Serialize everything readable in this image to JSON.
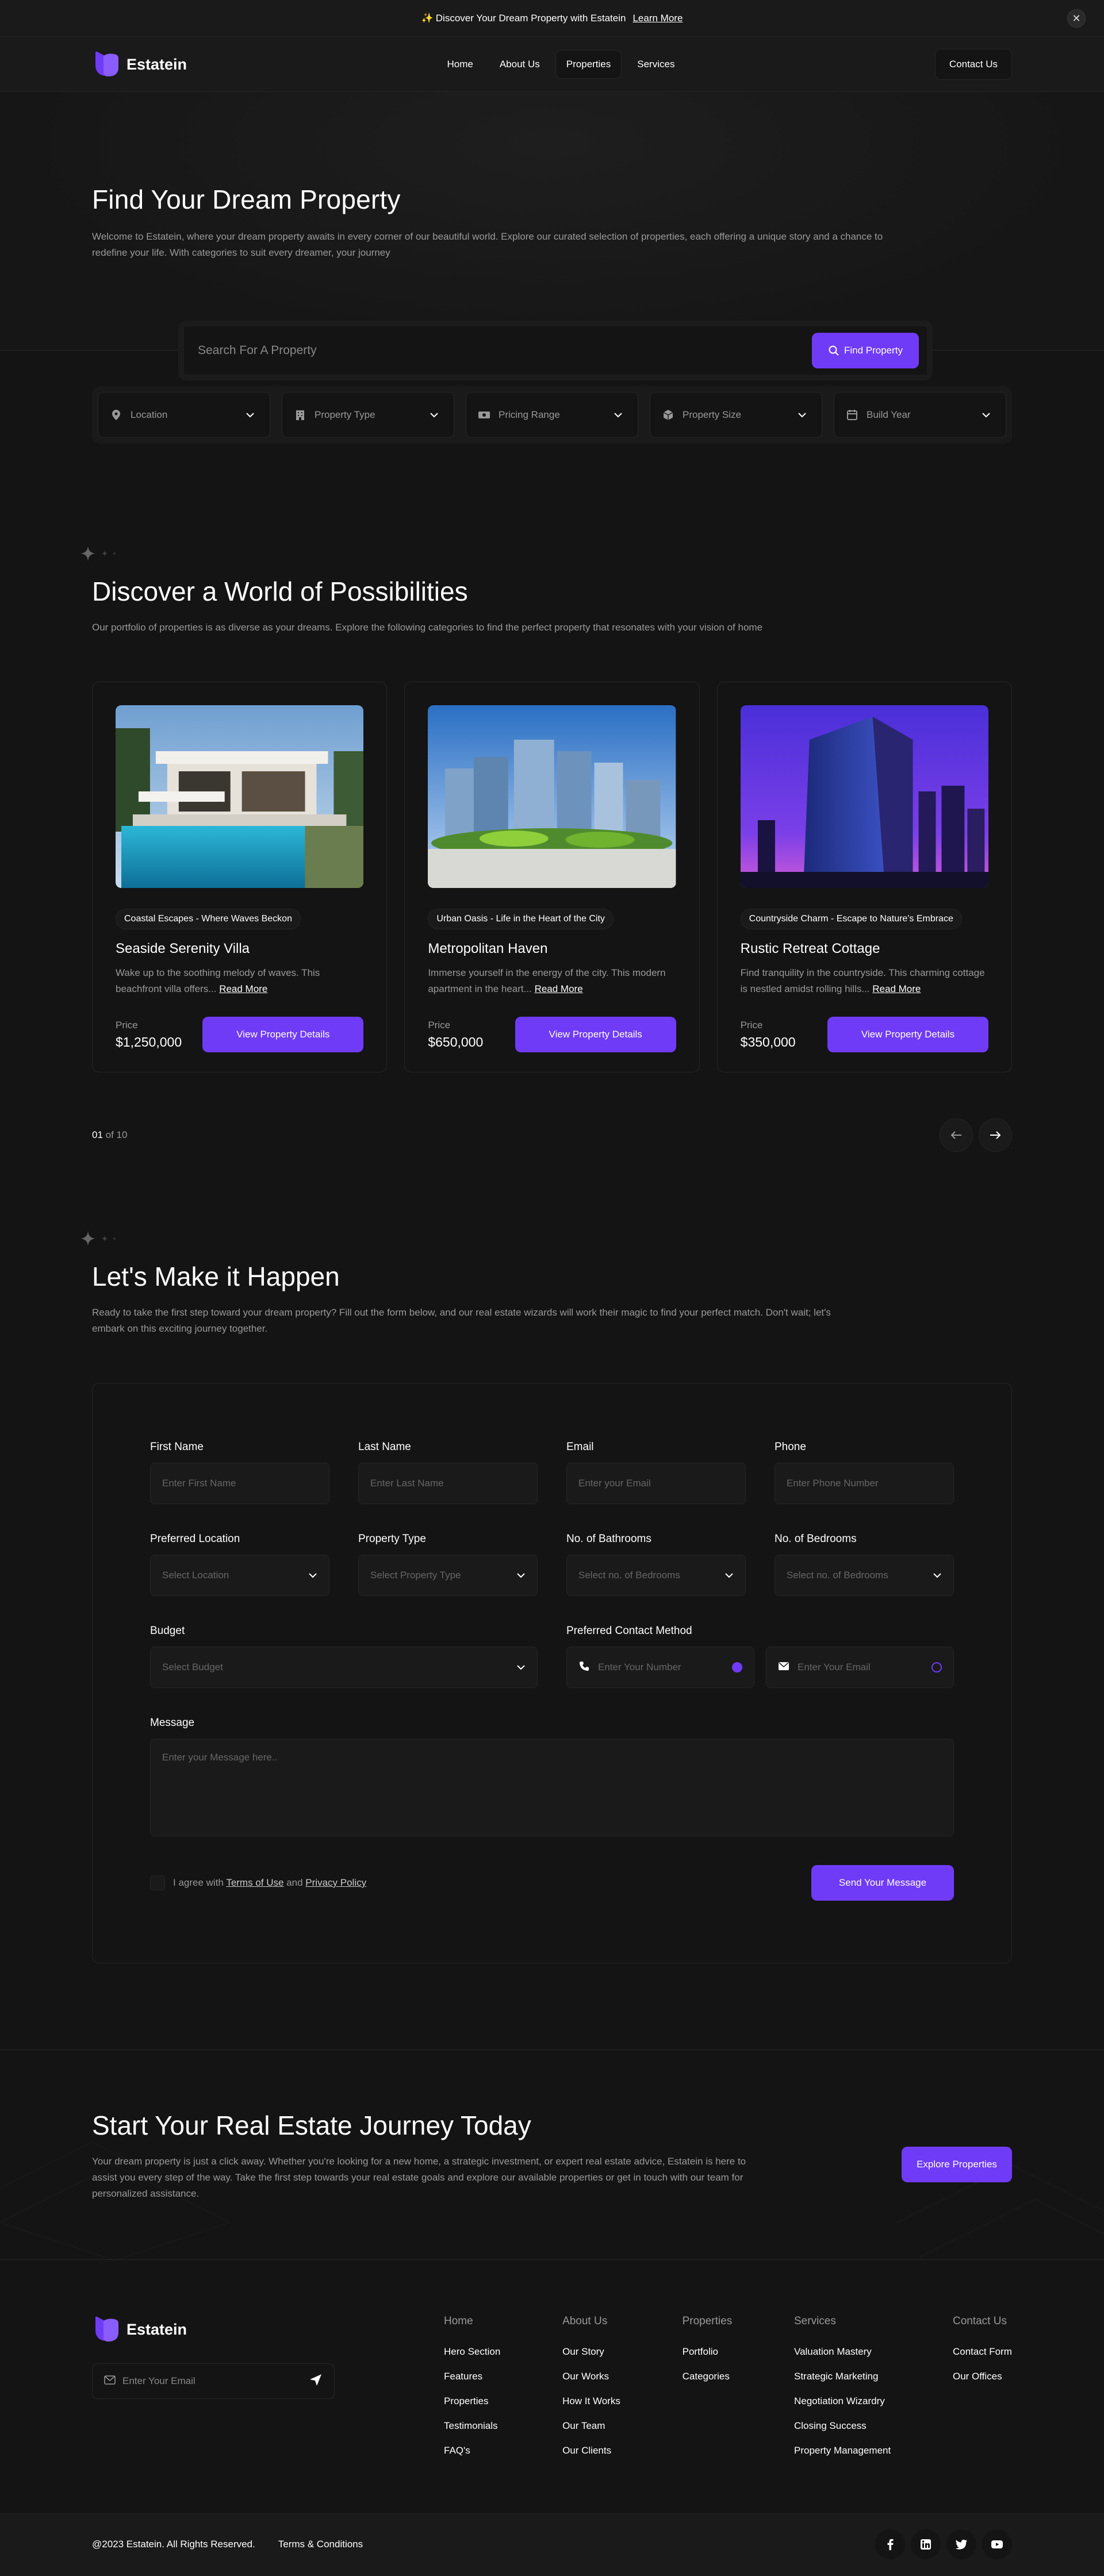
{
  "banner": {
    "text": "Discover Your Dream Property with Estatein",
    "link": "Learn More"
  },
  "brand": {
    "name": "Estatein",
    "accent": "#703bf7"
  },
  "nav": {
    "items": [
      "Home",
      "About Us",
      "Properties",
      "Services"
    ],
    "contact": "Contact Us"
  },
  "hero": {
    "title": "Find Your Dream Property",
    "text": "Welcome to Estatein, where your dream property awaits in every corner of our beautiful world. Explore our curated selection of properties, each offering a unique story and a chance to redefine your life. With categories to suit every dreamer, your journey"
  },
  "search": {
    "placeholder": "Search For A Property",
    "button": "Find Property",
    "filters": [
      "Location",
      "Property Type",
      "Pricing Range",
      "Property Size",
      "Build Year"
    ]
  },
  "discover": {
    "title": "Discover a World of Possibilities",
    "text": "Our portfolio of properties is as diverse as your dreams. Explore the following categories to find the perfect property that resonates with your vision of home",
    "price_label": "Price",
    "details_button": "View Property Details",
    "read_more": "Read More",
    "cards": [
      {
        "tag": "Coastal Escapes - Where Waves Beckon",
        "title": "Seaside Serenity Villa",
        "desc": "Wake up to the soothing melody of waves. This beachfront villa offers...",
        "price": "$1,250,000"
      },
      {
        "tag": "Urban Oasis - Life in the Heart of the City",
        "title": "Metropolitan Haven",
        "desc": "Immerse yourself in the energy of the city. This modern apartment in the heart...",
        "price": "$650,000"
      },
      {
        "tag": "Countryside Charm - Escape to Nature's Embrace",
        "title": "Rustic Retreat Cottage",
        "desc": "Find tranquility in the countryside. This charming cottage is nestled amidst rolling hills...",
        "price": "$350,000"
      }
    ],
    "pager": {
      "current": "01",
      "of": "of 10"
    }
  },
  "form": {
    "title": "Let's Make it Happen",
    "text": "Ready to take the first step toward your dream property? Fill out the form below, and our real estate wizards will work their magic to find your perfect match. Don't wait; let's embark on this exciting journey together.",
    "first_name": {
      "label": "First Name",
      "placeholder": "Enter First Name"
    },
    "last_name": {
      "label": "Last Name",
      "placeholder": "Enter Last Name"
    },
    "email": {
      "label": "Email",
      "placeholder": "Enter your Email"
    },
    "phone": {
      "label": "Phone",
      "placeholder": "Enter Phone Number"
    },
    "location": {
      "label": "Preferred Location",
      "placeholder": "Select Location"
    },
    "type": {
      "label": "Property Type",
      "placeholder": "Select Property Type"
    },
    "bathrooms": {
      "label": "No. of Bathrooms",
      "placeholder": "Select no. of Bedrooms"
    },
    "bedrooms": {
      "label": "No. of Bedrooms",
      "placeholder": "Select no. of Bedrooms"
    },
    "budget": {
      "label": "Budget",
      "placeholder": "Select Budget"
    },
    "contact_method": {
      "label": "Preferred Contact Method",
      "phone_placeholder": "Enter Your Number",
      "email_placeholder": "Enter Your Email"
    },
    "message": {
      "label": "Message",
      "placeholder": "Enter your Message here.."
    },
    "agree_prefix": "I agree with",
    "terms": "Terms of Use",
    "and": "and",
    "privacy": "Privacy Policy",
    "submit": "Send Your Message"
  },
  "cta": {
    "title": "Start Your Real Estate Journey Today",
    "text": "Your dream property is just a click away. Whether you're looking for a new home, a strategic investment, or expert real estate advice, Estatein is here to assist you every step of the way. Take the first step towards your real estate goals and explore our available properties or get in touch with our team for personalized assistance.",
    "button": "Explore Properties"
  },
  "footer": {
    "email_placeholder": "Enter Your Email",
    "columns": [
      {
        "title": "Home",
        "items": [
          "Hero Section",
          "Features",
          "Properties",
          "Testimonials",
          "FAQ's"
        ]
      },
      {
        "title": "About Us",
        "items": [
          "Our Story",
          "Our Works",
          "How It Works",
          "Our Team",
          "Our Clients"
        ]
      },
      {
        "title": "Properties",
        "items": [
          "Portfolio",
          "Categories"
        ]
      },
      {
        "title": "Services",
        "items": [
          "Valuation Mastery",
          "Strategic Marketing",
          "Negotiation Wizardry",
          "Closing Success",
          "Property Management"
        ]
      },
      {
        "title": "Contact Us",
        "items": [
          "Contact Form",
          "Our Offices"
        ]
      }
    ],
    "copyright": "@2023 Estatein. All Rights Reserved.",
    "terms": "Terms & Conditions",
    "socials": [
      "facebook-icon",
      "linkedin-icon",
      "twitter-icon",
      "youtube-icon"
    ]
  }
}
